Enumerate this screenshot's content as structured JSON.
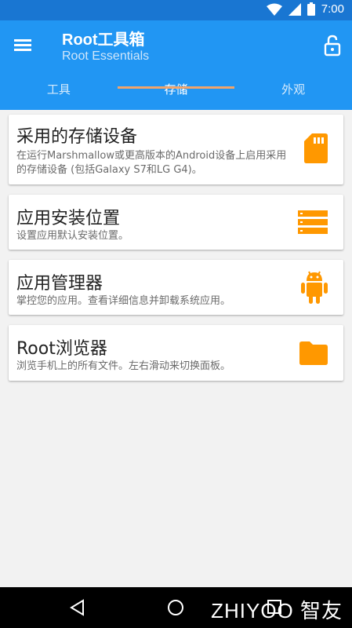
{
  "status_bar": {
    "time": "7:00",
    "icons": [
      "wifi-icon",
      "signal-icon",
      "battery-icon"
    ]
  },
  "app_bar": {
    "title": "Root工具箱",
    "subtitle": "Root Essentials",
    "menu_icon": "menu-icon",
    "lock_icon": "lock-open-icon"
  },
  "tabs": [
    {
      "label": "工具",
      "active": false
    },
    {
      "label": "存储",
      "active": true
    },
    {
      "label": "外观",
      "active": false
    }
  ],
  "items": [
    {
      "title": "采用的存储设备",
      "desc": "在运行Marshmallow或更高版本的Android设备上启用采用的存储设备 (包括Galaxy S7和LG G4)。",
      "icon": "sd-card-icon"
    },
    {
      "title": "应用安装位置",
      "desc": "设置应用默认安装位置。",
      "icon": "storage-list-icon"
    },
    {
      "title": "应用管理器",
      "desc": "掌控您的应用。查看详细信息并卸载系统应用。",
      "icon": "android-icon"
    },
    {
      "title": "Root浏览器",
      "desc": "浏览手机上的所有文件。左右滑动来切换面板。",
      "icon": "folder-icon"
    }
  ],
  "nav_bar": {
    "buttons": [
      "back-icon",
      "home-icon",
      "recents-icon"
    ]
  },
  "watermark": "ZHIYOO 智友",
  "colors": {
    "primary": "#2196f3",
    "primary_dark": "#1976d2",
    "accent": "#ff9800",
    "tab_indicator": "#f0a46b"
  }
}
